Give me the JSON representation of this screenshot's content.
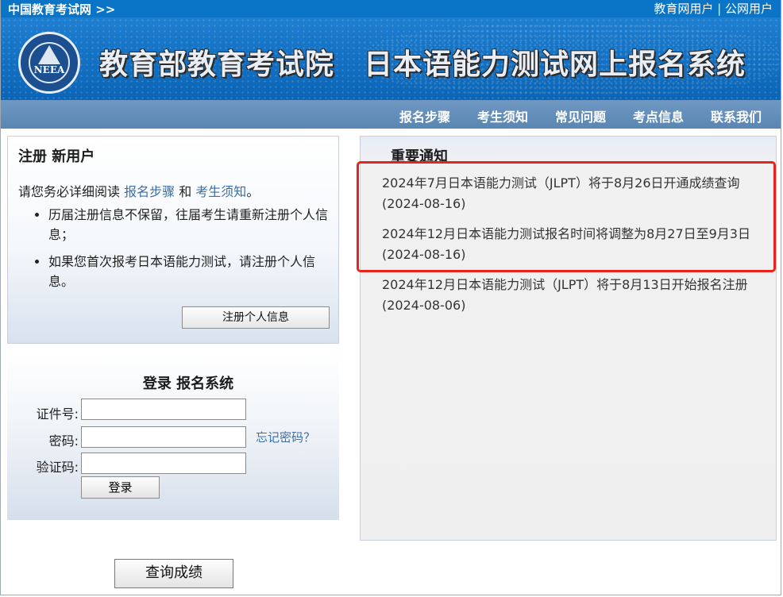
{
  "topbar": {
    "site_link": "中国教育考试网 >>",
    "edu_user": "教育网用户",
    "separator": "|",
    "public_user": "公网用户"
  },
  "banner": {
    "logo_text": "NEEA",
    "title": "教育部教育考试院　日本语能力测试网上报名系统"
  },
  "nav": {
    "items": [
      "报名步骤",
      "考生须知",
      "常见问题",
      "考点信息",
      "联系我们"
    ]
  },
  "register": {
    "title": "注册 新用户",
    "intro_prefix": "请您务必详细阅读 ",
    "link_steps": "报名步骤",
    "intro_and": " 和 ",
    "link_notice": "考生须知",
    "intro_suffix": "。",
    "bullets": [
      "历届注册信息不保留，往届考生请重新注册个人信息；",
      "如果您首次报考日本语能力测试，请注册个人信息。"
    ],
    "button": "注册个人信息"
  },
  "login": {
    "title": "登录 报名系统",
    "id_label": "证件号:",
    "password_label": "密码:",
    "captcha_label": "验证码:",
    "forgot": "忘记密码？",
    "button": "登录"
  },
  "score_button": "查询成绩",
  "notices": {
    "title": "重要通知",
    "items": [
      "2024年7月日本语能力测试（JLPT）将于8月26日开通成绩查询 (2024-08-16)",
      "2024年12月日本语能力测试报名时间将调整为8月27日至9月3日 (2024-08-16)",
      "2024年12月日本语能力测试（JLPT）将于8月13日开始报名注册 (2024-08-06)"
    ]
  },
  "colors": {
    "topbar": "#0a74c6",
    "nav": "#5a86b3",
    "link": "#3a6ea5",
    "highlight": "#e8231b"
  }
}
